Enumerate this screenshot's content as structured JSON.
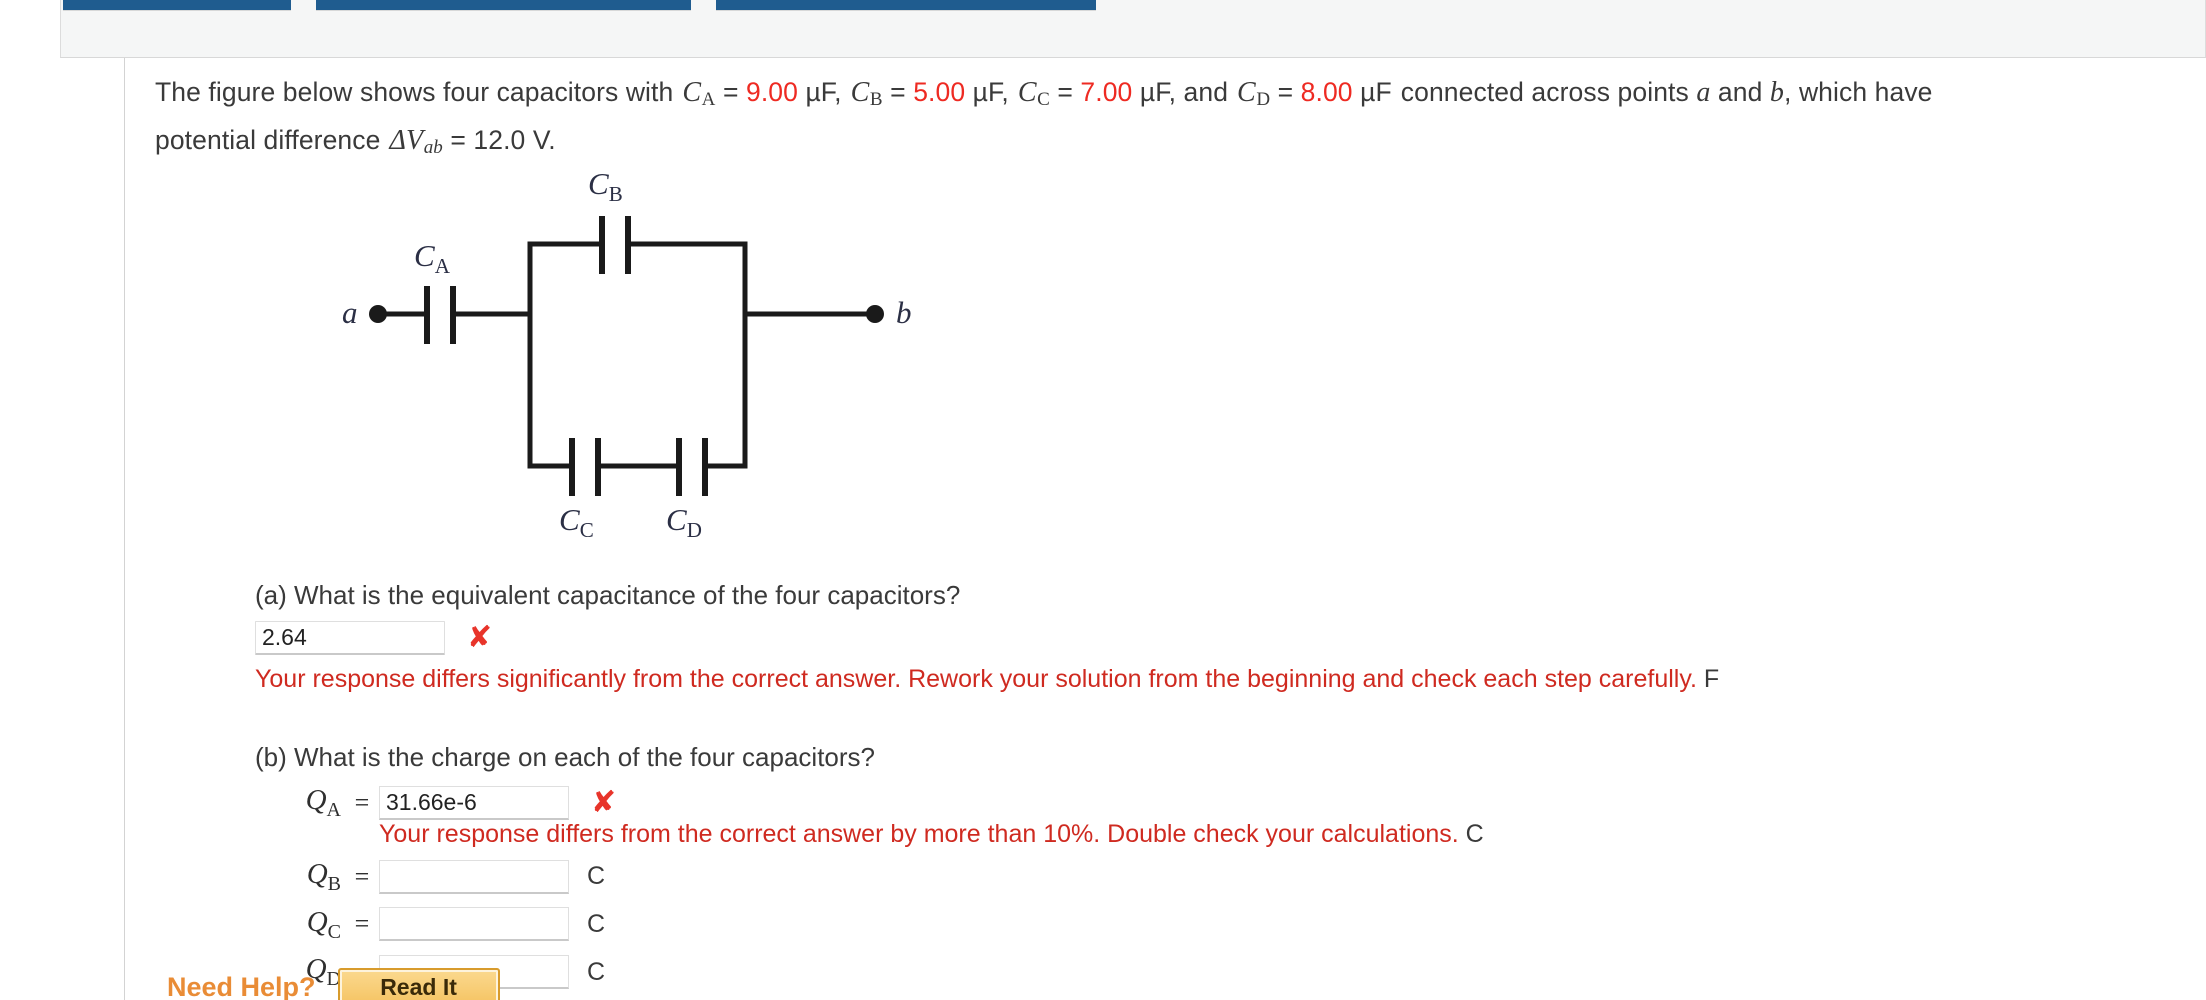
{
  "toolbar": {
    "tabs": [
      {
        "label": ""
      },
      {
        "label": ""
      },
      {
        "label": ""
      }
    ]
  },
  "problem": {
    "lead": "The figure below shows four capacitors with",
    "cap_a_symbol": "C",
    "cap_a_sub": "A",
    "cap_a_value": "9.00",
    "cap_b_symbol": "C",
    "cap_b_sub": "B",
    "cap_b_value": "5.00",
    "cap_c_symbol": "C",
    "cap_c_sub": "C",
    "cap_c_value": "7.00",
    "cap_d_symbol": "C",
    "cap_d_sub": "D",
    "cap_d_value": "8.00",
    "unit_uf": "µF",
    "eq": "=",
    "comma": ",",
    "and_word": "and",
    "tail": "connected across points",
    "point_a": "a",
    "and_word2": "and",
    "point_b": "b",
    "tail2": ", which have",
    "line2_lead": "potential difference",
    "delta_v_symbol": "ΔV",
    "delta_v_sub": "ab",
    "delta_v_value": "12.0 V."
  },
  "figure": {
    "label_a": "a",
    "label_b": "b",
    "cap_a_label": "C",
    "cap_a_sub": "A",
    "cap_b_label": "C",
    "cap_b_sub": "B",
    "cap_c_label": "C",
    "cap_c_sub": "C",
    "cap_d_label": "C",
    "cap_d_sub": "D",
    "line_color": "#1a1a1a",
    "label_color": "#2b2f45"
  },
  "part_a": {
    "question": "(a) What is the equivalent capacitance of the four capacitors?",
    "input_value": "2.64",
    "input_placeholder": "",
    "status_icon": "x-mark-icon",
    "error_message": "Your response differs significantly from the correct answer. Rework your solution from the beginning and check each step carefully.",
    "unit": "F",
    "error_color": "#cf2a20"
  },
  "part_b": {
    "question": "(b) What is the charge on each of the four capacitors?",
    "rows": [
      {
        "symbol": "Q",
        "sub": "A",
        "eq": "=",
        "value": "31.66e-6",
        "unit": "C",
        "status_icon": "x-mark-icon",
        "error_message": "Your response differs from the correct answer by more than 10%. Double check your calculations."
      },
      {
        "symbol": "Q",
        "sub": "B",
        "eq": "=",
        "value": "",
        "unit": "C",
        "status_icon": "",
        "error_message": ""
      },
      {
        "symbol": "Q",
        "sub": "C",
        "eq": "=",
        "value": "",
        "unit": "C",
        "status_icon": "",
        "error_message": ""
      },
      {
        "symbol": "Q",
        "sub": "D",
        "eq": "=",
        "value": "",
        "unit": "C",
        "status_icon": "",
        "error_message": ""
      }
    ]
  },
  "footer": {
    "need_help_label": "Need Help?",
    "read_it_label": "Read It",
    "need_help_color": "#e98c36"
  }
}
